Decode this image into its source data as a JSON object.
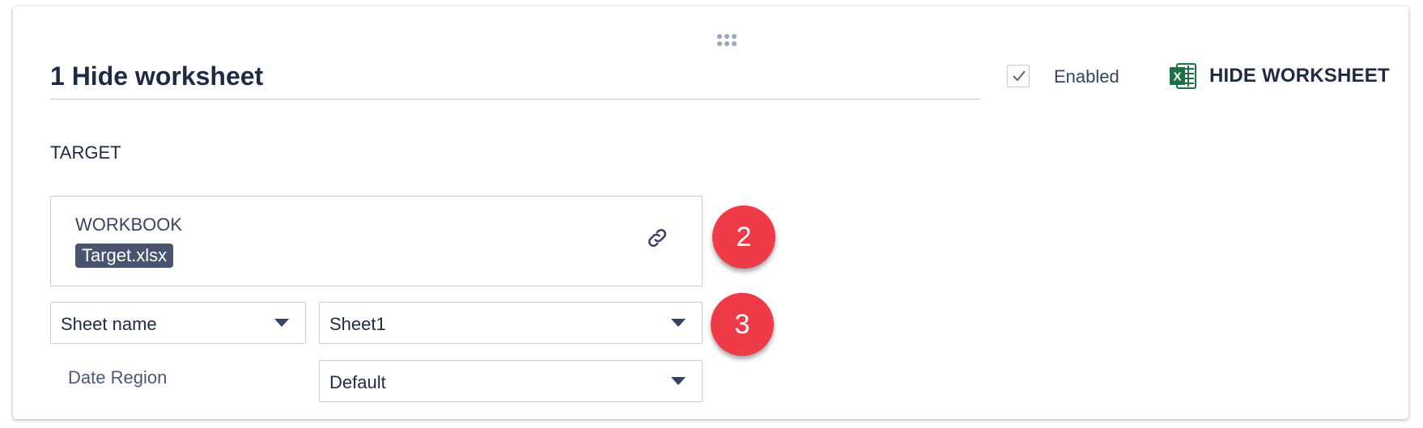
{
  "step": {
    "title": "1 Hide worksheet",
    "enabled_label": "Enabled",
    "enabled": true,
    "action_label": "HIDE WORKSHEET",
    "action_icon": "excel-icon"
  },
  "target": {
    "section_label": "TARGET",
    "workbook": {
      "label": "WORKBOOK",
      "value": "Target.xlsx",
      "link_icon": "link-icon"
    },
    "sheet_mode_select": {
      "value": "Sheet name"
    },
    "sheet_select": {
      "value": "Sheet1"
    },
    "date_region": {
      "label": "Date Region",
      "value": "Default"
    }
  },
  "badges": {
    "workbook_badge": "2",
    "sheet_badge": "3"
  },
  "colors": {
    "badge": "#ef3b48",
    "chip": "#4a5470",
    "excel_green": "#1d7044",
    "text": "#1f2a44"
  }
}
